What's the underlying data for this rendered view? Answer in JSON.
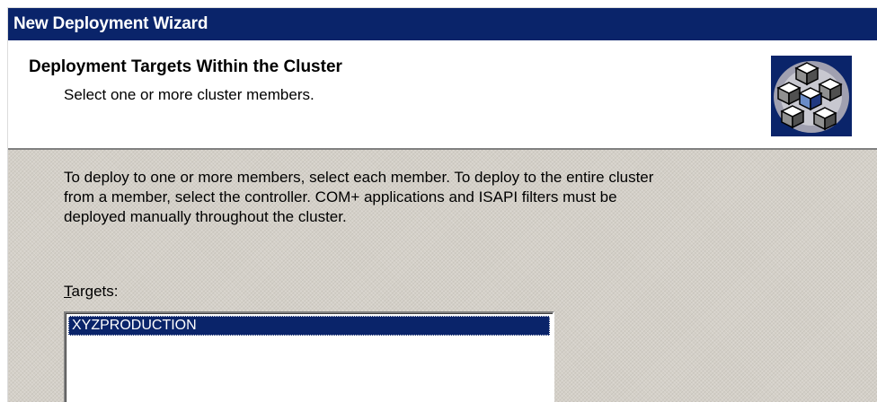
{
  "window": {
    "title": "New Deployment Wizard"
  },
  "header": {
    "title": "Deployment Targets Within the Cluster",
    "subtitle": "Select one or more cluster members.",
    "icon": "cluster-cubes-icon"
  },
  "body": {
    "description": [
      "To deploy to one or more members, select each member.  To deploy to the entire cluster",
      "from a member, select the controller.  COM+ applications and ISAPI filters must be",
      "deployed manually throughout the cluster."
    ],
    "targets_label_accel": "T",
    "targets_label_rest": "argets:",
    "targets": [
      {
        "name": "XYZPRODUCTION",
        "selected": true
      }
    ]
  },
  "colors": {
    "title_bar": "#0a246a",
    "selection": "#0a246a",
    "dialog_face": "#d4d0c8"
  }
}
